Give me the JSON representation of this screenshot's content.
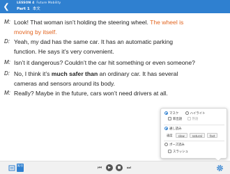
{
  "header": {
    "lesson": "LESSON 4",
    "lesson_title": "Future Mobility",
    "part": "Part 1",
    "part_suffix": "本文"
  },
  "dialog": [
    {
      "speaker": "M:",
      "text_a": "Look!  That woman isn’t holding the steering wheel.  ",
      "text_b": "The wheel is"
    },
    {
      "speaker": "",
      "text_a": "moving by itself.",
      "orange": true
    },
    {
      "speaker": "D:",
      "text_a": "Yeah, my dad has the same car.  It has an automatic parking"
    },
    {
      "speaker": "",
      "text_a": "function.  He says it’s very convenient."
    },
    {
      "speaker": "M:",
      "text_a": "Isn’t it dangerous?  Couldn’t the car hit something or even someone?"
    },
    {
      "speaker": "D:",
      "text_a": "No, I think it’s ",
      "bold": "much safer than",
      "text_c": " an ordinary car.  It has several"
    },
    {
      "speaker": "",
      "text_a": "cameras and sensors around its body."
    },
    {
      "speaker": "M:",
      "text_a": "Really?  Maybe in the future, cars won’t need drivers at all."
    }
  ],
  "settings": {
    "mask_label": "マスク",
    "highlight_label": "ハイライト",
    "new_words_label": "新出語",
    "idiom_label": "熟語",
    "read_through_label": "通し読み",
    "speed_label": "速度",
    "speeds": [
      "slow",
      "natural",
      "fast"
    ],
    "pause_label": "ポーズ読み",
    "slash_label": "スラッシュ"
  },
  "bottom": {
    "lang_badge": "英/日",
    "icons": [
      "document-icon",
      "previous-icon",
      "play-icon",
      "stop-icon",
      "next-icon",
      "gear-icon"
    ]
  },
  "colors": {
    "header": "#2f80d0",
    "highlight": "#e2641f",
    "accent": "#2f80d0"
  }
}
